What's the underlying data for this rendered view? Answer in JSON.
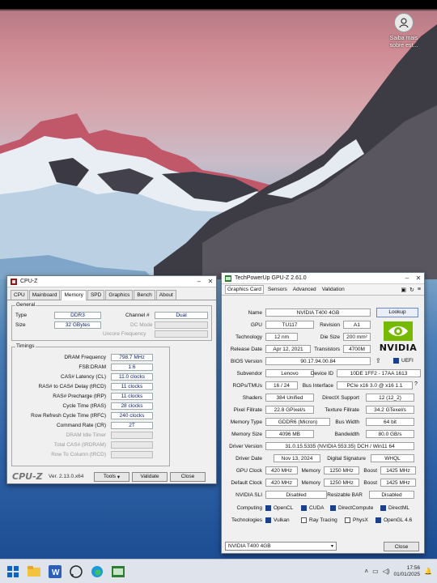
{
  "desktop": {
    "user_widget_line1": "Saiba mais",
    "user_widget_line2": "sobre est..."
  },
  "cpuz": {
    "title": "CPU-Z",
    "tabs": [
      "CPU",
      "Mainboard",
      "Memory",
      "SPD",
      "Graphics",
      "Bench",
      "About"
    ],
    "active_tab": "Memory",
    "general": {
      "label": "General",
      "type_label": "Type",
      "type_value": "DDR3",
      "size_label": "Size",
      "size_value": "32 GBytes",
      "channel_label": "Channel #",
      "channel_value": "Dual",
      "dc_mode_label": "DC Mode",
      "uncore_label": "Uncore Frequency"
    },
    "timings": {
      "label": "Timings",
      "rows": [
        {
          "label": "DRAM Frequency",
          "value": "798.7 MHz"
        },
        {
          "label": "FSB:DRAM",
          "value": "1:6"
        },
        {
          "label": "CAS# Latency (CL)",
          "value": "11.0 clocks"
        },
        {
          "label": "RAS# to CAS# Delay (tRCD)",
          "value": "11 clocks"
        },
        {
          "label": "RAS# Precharge (tRP)",
          "value": "11 clocks"
        },
        {
          "label": "Cycle Time (tRAS)",
          "value": "28 clocks"
        },
        {
          "label": "Row Refresh Cycle Time (tRFC)",
          "value": "240 clocks"
        },
        {
          "label": "Command Rate (CR)",
          "value": "2T"
        }
      ],
      "dim_rows": [
        "DRAM Idle Timer",
        "Total CAS# (tRDRAM)",
        "Row To Column (tRCD)"
      ]
    },
    "footer": {
      "logo": "CPU-Z",
      "version": "Ver. 2.13.0.x64",
      "tools": "Tools",
      "validate": "Validate",
      "close": "Close"
    }
  },
  "gpuz": {
    "title": "TechPowerUp GPU-Z 2.61.0",
    "tabs": [
      "Graphics Card",
      "Sensors",
      "Advanced",
      "Validation"
    ],
    "active_tab": "Graphics Card",
    "name_label": "Name",
    "name_value": "NVIDIA T400 4GB",
    "lookup": "Lookup",
    "gpu_label": "GPU",
    "gpu_value": "TU117",
    "revision_label": "Revision",
    "revision_value": "A1",
    "tech_label": "Technology",
    "tech_value": "12 nm",
    "diesize_label": "Die Size",
    "diesize_value": "200 mm²",
    "release_label": "Release Date",
    "release_value": "Apr 12, 2021",
    "transistors_label": "Transistors",
    "transistors_value": "4700M",
    "bios_label": "BIOS Version",
    "bios_value": "90.17.94.00.84",
    "uefi_label": "UEFI",
    "subvendor_label": "Subvendor",
    "subvendor_value": "Lenovo",
    "deviceid_label": "Device ID",
    "deviceid_value": "10DE 1FF2 - 17AA 1613",
    "rops_label": "ROPs/TMUs",
    "rops_value": "16 / 24",
    "bus_label": "Bus Interface",
    "bus_value": "PCIe x16 3.0 @ x16 1.1",
    "shaders_label": "Shaders",
    "shaders_value": "384 Unified",
    "dx_label": "DirectX Support",
    "dx_value": "12 (12_2)",
    "pixel_label": "Pixel Fillrate",
    "pixel_value": "22.8 GPixel/s",
    "texture_label": "Texture Fillrate",
    "texture_value": "34.2 GTexel/s",
    "memtype_label": "Memory Type",
    "memtype_value": "GDDR6 (Micron)",
    "buswidth_label": "Bus Width",
    "buswidth_value": "64 bit",
    "memsize_label": "Memory Size",
    "memsize_value": "4096 MB",
    "bandwidth_label": "Bandwidth",
    "bandwidth_value": "80.0 GB/s",
    "driver_label": "Driver Version",
    "driver_value": "31.0.15.5335 (NVIDIA 553.35) DCH / Win11 64",
    "driverdate_label": "Driver Date",
    "driverdate_value": "Nov 13, 2024",
    "digsig_label": "Digital Signature",
    "digsig_value": "WHQL",
    "gpuclock_label": "GPU Clock",
    "gpuclock_value": "420 MHz",
    "memory_label": "Memory",
    "mem_clock_value": "1250 MHz",
    "boost_label": "Boost",
    "boost_value": "1425 MHz",
    "defclock_label": "Default Clock",
    "defclock_value": "420 MHz",
    "def_mem_value": "1250 MHz",
    "def_boost_value": "1425 MHz",
    "sli_label": "NVIDIA SLI",
    "sli_value": "Disabled",
    "rebar_label": "Resizable BAR",
    "rebar_value": "Disabled",
    "computing_label": "Computing",
    "computing": [
      "OpenCL",
      "CUDA",
      "DirectCompute",
      "DirectML"
    ],
    "technologies_label": "Technologies",
    "technologies": [
      "Vulkan",
      "Ray Tracing",
      "PhysX",
      "OpenGL 4.6"
    ],
    "nvidia_logo": "NVIDIA",
    "selected_card": "NVIDIA T400 4GB",
    "close": "Close"
  },
  "taskbar": {
    "time": "17:56",
    "date": "01/01/2025"
  }
}
